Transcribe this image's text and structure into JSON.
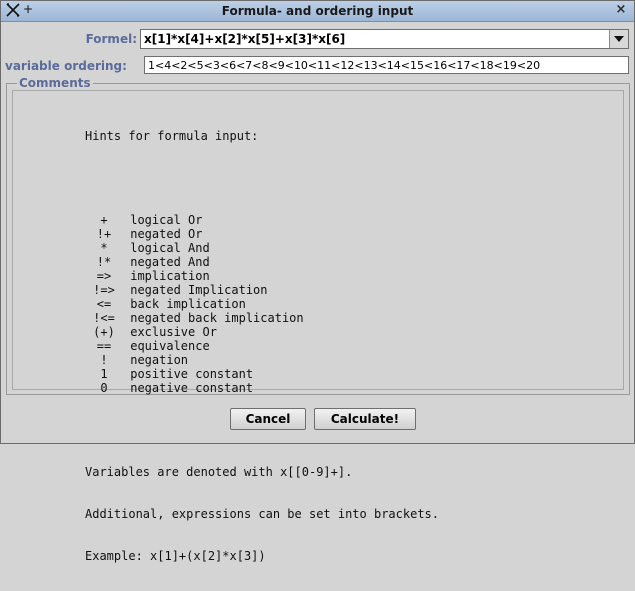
{
  "window": {
    "title": "Formula- and ordering input",
    "close_glyph": "×",
    "pin_glyph": "+"
  },
  "formula": {
    "label": "Formel:",
    "value": "x[1]*x[4]+x[2]*x[5]+x[3]*x[6]"
  },
  "ordering": {
    "label": "variable ordering:",
    "value": "1<4<2<5<3<6<7<8<9<10<11<12<13<14<15<16<17<18<19<20"
  },
  "comments": {
    "group_title": "Comments",
    "heading": "Hints for formula input:",
    "operators": [
      {
        "op": "+",
        "desc": "logical Or"
      },
      {
        "op": "!+",
        "desc": "negated Or"
      },
      {
        "op": "*",
        "desc": "logical And"
      },
      {
        "op": "!*",
        "desc": "negated And"
      },
      {
        "op": "=>",
        "desc": "implication"
      },
      {
        "op": "!=>",
        "desc": "negated Implication"
      },
      {
        "op": "<=",
        "desc": "back implication"
      },
      {
        "op": "!<=",
        "desc": "negated back implication"
      },
      {
        "op": "(+)",
        "desc": "exclusive Or"
      },
      {
        "op": "==",
        "desc": "equivalence"
      },
      {
        "op": "!",
        "desc": "negation"
      },
      {
        "op": "1",
        "desc": "positive constant"
      },
      {
        "op": "0",
        "desc": "negative constant"
      }
    ],
    "notes": [
      "Variables are denoted with x[[0-9]+].",
      "Additional, expressions can be set into brackets.",
      "Example: x[1]+(x[2]*x[3])"
    ]
  },
  "buttons": {
    "cancel": "Cancel",
    "calculate": "Calculate!"
  },
  "colors": {
    "label_blue": "#5b6c9a",
    "background": "#d4d4d4",
    "titlebar": "#9cb6d6"
  }
}
